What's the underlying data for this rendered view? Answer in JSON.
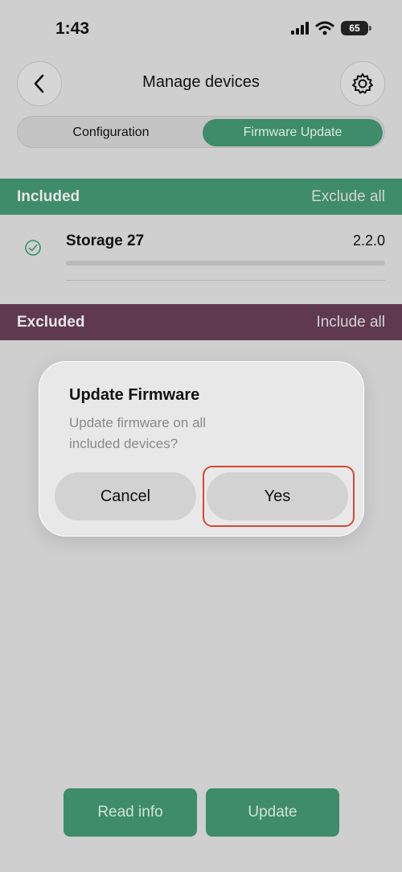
{
  "status_bar": {
    "time": "1:43",
    "battery": "65"
  },
  "header": {
    "title": "Manage devices"
  },
  "tabs": [
    {
      "label": "Configuration",
      "selected": false
    },
    {
      "label": "Firmware Update",
      "selected": true
    }
  ],
  "included": {
    "title": "Included",
    "action": "Exclude all",
    "devices": [
      {
        "name": "Storage 27",
        "version": "2.2.0"
      }
    ]
  },
  "excluded": {
    "title": "Excluded",
    "action": "Include all"
  },
  "footer": {
    "read_info_label": "Read info",
    "update_label": "Update"
  },
  "dialog": {
    "title": "Update Firmware",
    "message": "Update firmware on all included devices?",
    "cancel_label": "Cancel",
    "confirm_label": "Yes"
  },
  "colors": {
    "accent": "#3e8c69",
    "excluded": "#5f3a4f",
    "highlight": "#d34a33"
  }
}
